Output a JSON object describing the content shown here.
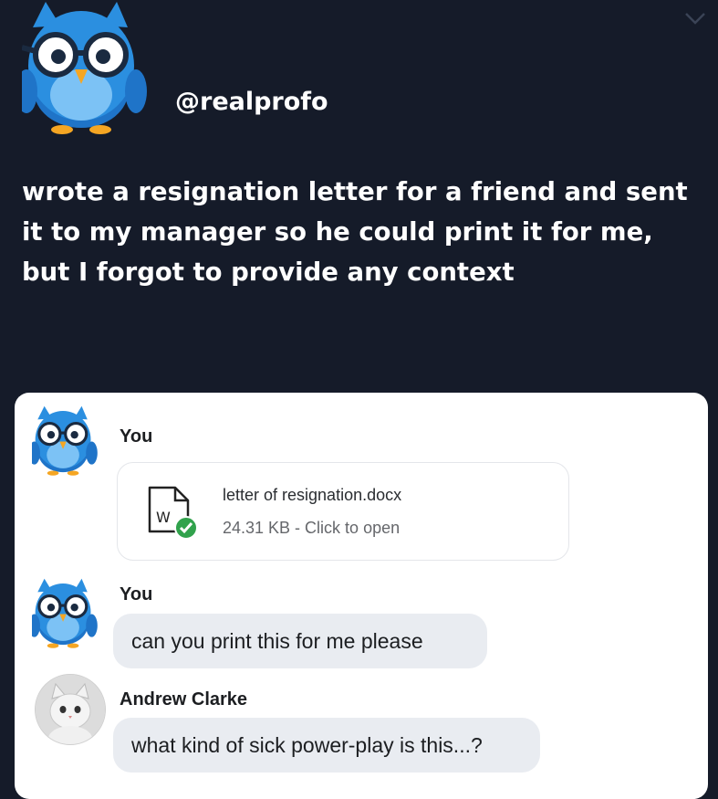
{
  "header": {
    "handle": "@realprofo"
  },
  "post": {
    "text": "wrote a resignation letter for a friend and sent it to my manager so he could print it for me, but I forgot to provide any context"
  },
  "chat": {
    "messages": [
      {
        "sender": "You",
        "type": "file",
        "file_name": "letter of resignation.docx",
        "file_meta": "24.31 KB - Click to open",
        "file_icon_letter": "W"
      },
      {
        "sender": "You",
        "type": "text",
        "text": "can you print this for me please"
      },
      {
        "sender": "Andrew Clarke",
        "type": "text",
        "text": "what kind of sick power-play is this...?"
      }
    ]
  },
  "colors": {
    "background": "#151b29",
    "owl_blue": "#2b8fe0",
    "bubble": "#e9ecf1",
    "check_green": "#31a24c"
  }
}
